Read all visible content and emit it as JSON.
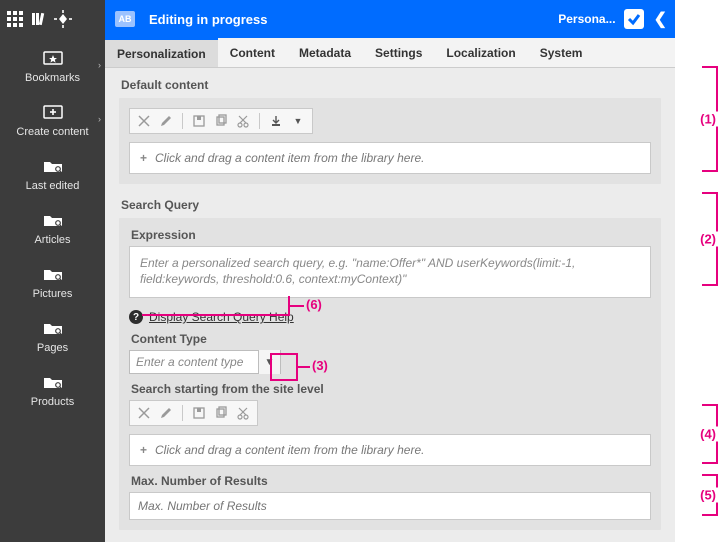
{
  "topbar": {
    "badge": "AB",
    "title": "Editing in progress",
    "persona": "Persona..."
  },
  "tabs": [
    "Personalization",
    "Content",
    "Metadata",
    "Settings",
    "Localization",
    "System"
  ],
  "sidebar": {
    "items": [
      {
        "label": "Bookmarks"
      },
      {
        "label": "Create content"
      },
      {
        "label": "Last edited"
      },
      {
        "label": "Articles"
      },
      {
        "label": "Pictures"
      },
      {
        "label": "Pages"
      },
      {
        "label": "Products"
      }
    ]
  },
  "main": {
    "default_content": {
      "label": "Default content",
      "drop_hint": "Click and drag a content item from the library here."
    },
    "search_query": {
      "label": "Search Query",
      "expression_label": "Expression",
      "expression_placeholder": "Enter a personalized search query, e.g. \"name:Offer*\" AND userKeywords(limit:-1, field:keywords, threshold:0.6, context:myContext)\"",
      "help_link": "Display Search Query Help",
      "content_type_label": "Content Type",
      "content_type_placeholder": "Enter a content type",
      "site_level_label": "Search starting from the site level",
      "site_level_drop_hint": "Click and drag a content item from the library here.",
      "max_results_label": "Max. Number of Results",
      "max_results_placeholder": "Max. Number of Results"
    }
  },
  "annotations": {
    "n1": "(1)",
    "n2": "(2)",
    "n3": "(3)",
    "n4": "(4)",
    "n5": "(5)",
    "n6": "(6)"
  }
}
